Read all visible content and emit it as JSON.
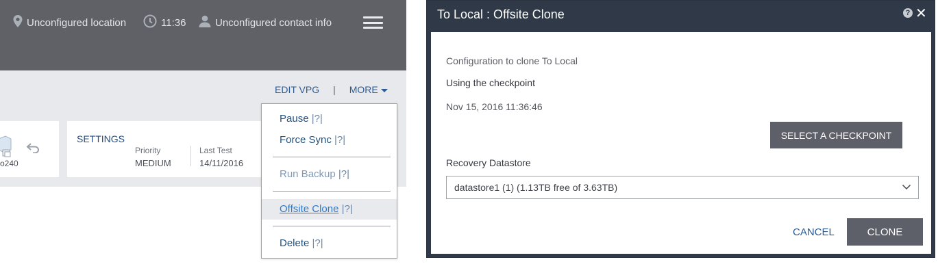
{
  "header": {
    "location": "Unconfigured location",
    "time": "11:36",
    "contact": "Unconfigured contact info"
  },
  "toolbar": {
    "edit_vpg": "EDIT VPG",
    "separator": "|",
    "more": "MORE"
  },
  "vpg_card": {
    "partial_number": "o240"
  },
  "settings_card": {
    "title": "SETTINGS",
    "priority_label": "Priority",
    "priority_value": "MEDIUM",
    "last_test_label": "Last Test",
    "last_test_value": "14/11/2016"
  },
  "more_menu": {
    "items": [
      {
        "label": "Pause",
        "help": "|?|"
      },
      {
        "label": "Force Sync",
        "help": "|?|"
      },
      {
        "label": "Run Backup",
        "help": "|?|"
      },
      {
        "label": "Offsite Clone",
        "help": "|?|"
      },
      {
        "label": "Delete",
        "help": "|?|"
      }
    ]
  },
  "dialog": {
    "title": "To Local : Offsite Clone",
    "help_icon": "?",
    "close_icon": "✕",
    "config_text": "Configuration to clone To Local",
    "checkpoint_label": "Using the checkpoint",
    "checkpoint_value": "Nov 15, 2016 11:36:46",
    "select_checkpoint_button": "SELECT A CHECKPOINT",
    "datastore_label": "Recovery Datastore",
    "datastore_value": "datastore1 (1) (1.13TB free of 3.63TB)",
    "cancel_button": "CANCEL",
    "clone_button": "CLONE"
  },
  "colors": {
    "topbar": "#5f6166",
    "dialog_header": "#2f3947",
    "link": "#2d5c94",
    "button": "#5d6068"
  }
}
